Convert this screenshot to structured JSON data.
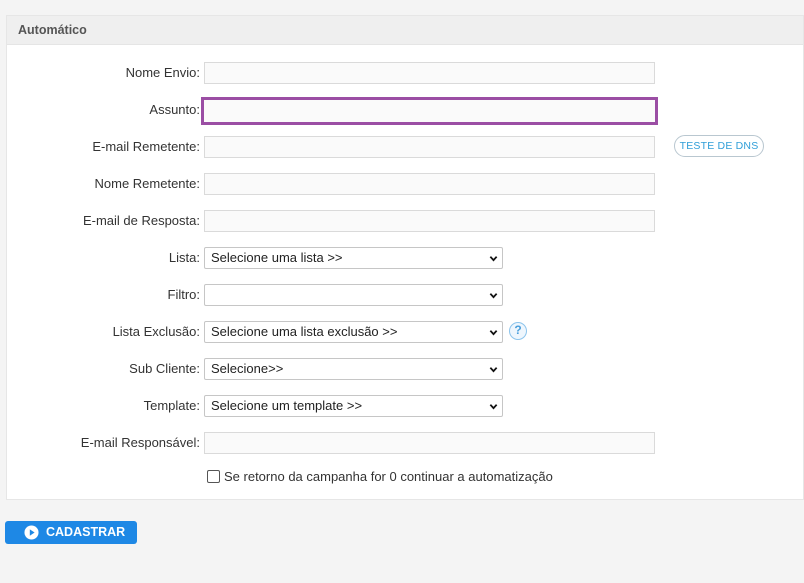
{
  "panel": {
    "title": "Automático"
  },
  "form": {
    "nome_envio_label": "Nome Envio:",
    "assunto_label": "Assunto:",
    "email_remetente_label": "E-mail Remetente:",
    "dns_button_label": "TESTE DE DNS",
    "nome_remetente_label": "Nome Remetente:",
    "email_resposta_label": "E-mail de Resposta:",
    "lista_label": "Lista:",
    "lista_value": "Selecione uma lista >>",
    "filtro_label": "Filtro:",
    "filtro_value": "",
    "lista_exclusao_label": "Lista Exclusão:",
    "lista_exclusao_value": "Selecione uma lista exclusão >>",
    "help_glyph": "?",
    "sub_cliente_label": "Sub Cliente:",
    "sub_cliente_value": "Selecione>>",
    "template_label": "Template:",
    "template_value": "Selecione um template >>",
    "email_responsavel_label": "E-mail Responsável:",
    "checkbox_label": "Se retorno da campanha for 0 continuar a automatização",
    "checkbox_checked": false
  },
  "actions": {
    "submit_label": "CADASTRAR"
  },
  "colors": {
    "focus_border": "#9b4ea4",
    "primary_button": "#1e88e5",
    "dns_text": "#2f9ed8",
    "help_icon": "#4a9fdc"
  },
  "icons": {
    "dropdown": "chevron-down-icon",
    "help": "help-icon",
    "submit": "play-circle-icon"
  }
}
